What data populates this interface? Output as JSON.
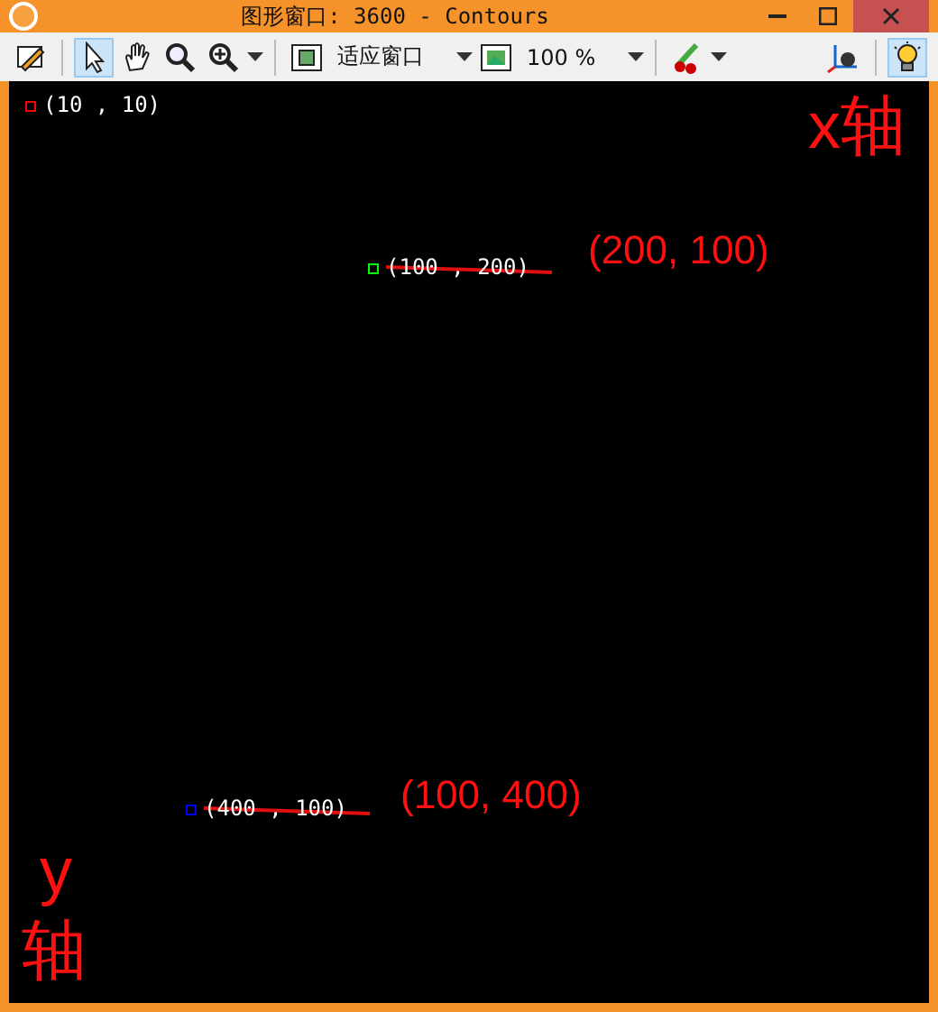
{
  "window": {
    "title": "图形窗口: 3600 - Contours"
  },
  "toolbar": {
    "tools": [
      {
        "kind": "icon",
        "selected": false,
        "dropdown": false
      },
      {
        "kind": "sep"
      },
      {
        "kind": "icon",
        "selected": true,
        "dropdown": false
      },
      {
        "kind": "icon",
        "selected": false,
        "dropdown": false
      },
      {
        "kind": "icon",
        "selected": false,
        "dropdown": false
      },
      {
        "kind": "icon",
        "selected": false,
        "dropdown": true
      },
      {
        "kind": "sep"
      },
      {
        "kind": "combo",
        "value": "适应窗口"
      },
      {
        "kind": "combo",
        "value": "100 %"
      },
      {
        "kind": "sep"
      },
      {
        "kind": "icon",
        "selected": false,
        "dropdown": true
      }
    ],
    "right_tools": [
      {
        "kind": "icon",
        "selected": false
      },
      {
        "kind": "icon",
        "selected": true
      }
    ]
  },
  "canvas": {
    "points": [
      {
        "label": "(10 , 10)",
        "color": "#ff0000",
        "struck": false
      },
      {
        "label": "(100 , 200)",
        "color": "#00ff00",
        "struck": true
      },
      {
        "label": "(400 , 100)",
        "color": "#0000ff",
        "struck": true
      }
    ],
    "annotations": [
      {
        "text": "(200, 100)"
      },
      {
        "text": "(100, 400)"
      },
      {
        "text": "x轴"
      },
      {
        "text": "y"
      },
      {
        "text": "轴"
      }
    ]
  }
}
